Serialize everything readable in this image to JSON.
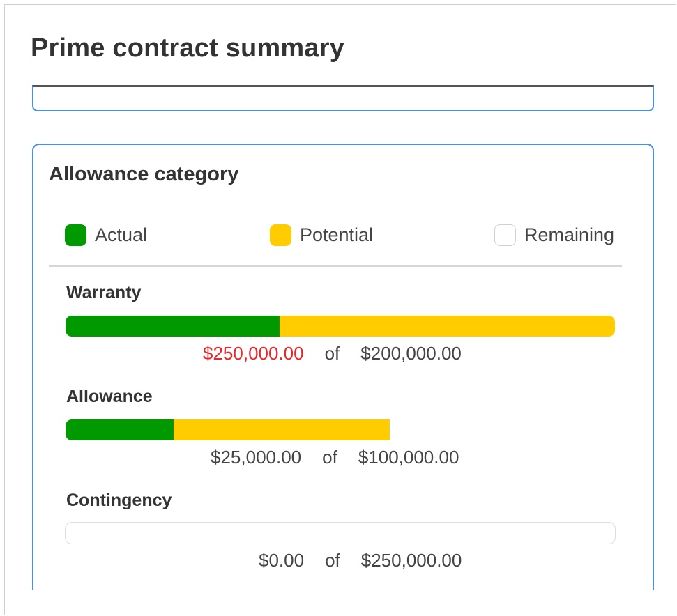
{
  "page": {
    "title": "Prime contract summary"
  },
  "card": {
    "title": "Allowance category",
    "legend": [
      {
        "label": "Actual",
        "icon": "actual-swatch",
        "color": "#009900"
      },
      {
        "label": "Potential",
        "icon": "potential-swatch",
        "color": "#ffcc00"
      },
      {
        "label": "Remaining",
        "icon": "remaining-swatch",
        "color": "#ffffff"
      }
    ],
    "categories": [
      {
        "label": "Warranty",
        "amount": "$250,000.00",
        "of": "of",
        "total": "$200,000.00",
        "actual_fraction": 0.39,
        "potential_fraction": 0.61,
        "amount_color": "#e8272b"
      },
      {
        "label": "Allowance",
        "amount": "$25,000.00",
        "of": "of",
        "total": "$100,000.00",
        "actual_fraction": 0.195,
        "potential_fraction": 0.39,
        "amount_color": "#444444"
      },
      {
        "label": "Contingency",
        "amount": "$0.00",
        "of": "of",
        "total": "$250,000.00",
        "actual_fraction": 0,
        "potential_fraction": 0,
        "amount_color": "#444444"
      }
    ]
  }
}
